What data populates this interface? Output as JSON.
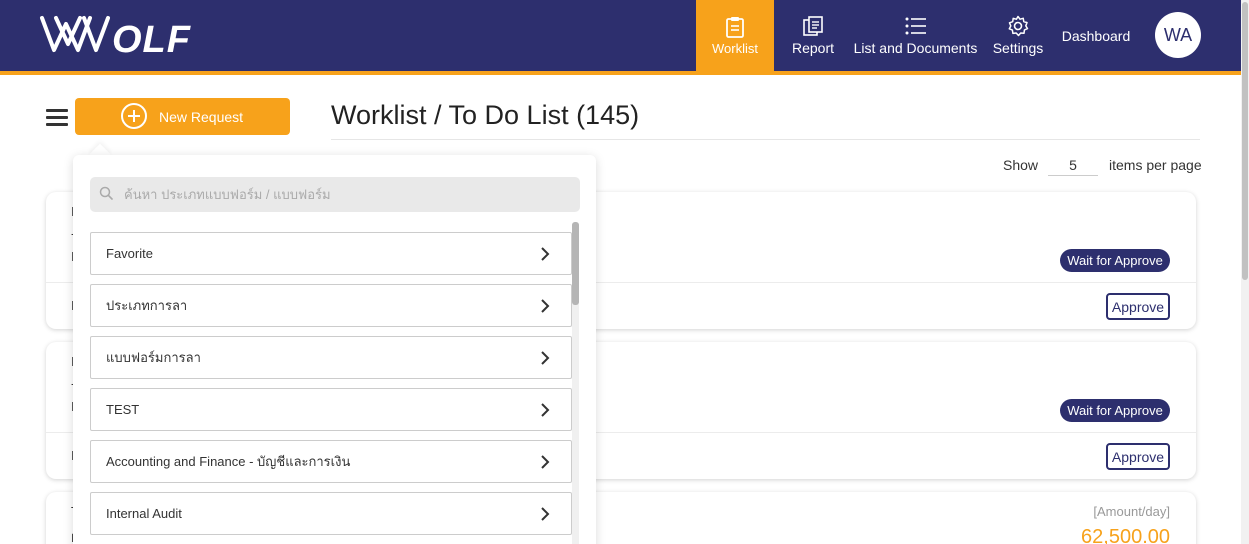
{
  "brand": {
    "logo_text": "WOLF"
  },
  "nav": {
    "items": [
      {
        "label": "Worklist",
        "icon": "clipboard-icon",
        "active": true
      },
      {
        "label": "Report",
        "icon": "report-icon",
        "active": false
      },
      {
        "label": "List and Documents",
        "icon": "list-icon",
        "active": false
      },
      {
        "label": "Settings",
        "icon": "gear-icon",
        "active": false
      },
      {
        "label": "Dashboard",
        "icon": "",
        "active": false
      }
    ],
    "avatar_initials": "WA"
  },
  "toolbar": {
    "new_request_label": "New Request"
  },
  "page": {
    "title": "Worklist / To Do List (145)",
    "show_label": "Show",
    "per_page_value": "5",
    "items_label": "items per page"
  },
  "cards": [
    {
      "stub_lines": [
        "I",
        "-",
        "I",
        "I"
      ],
      "status": "Wait for Approve",
      "action": "Approve"
    },
    {
      "stub_lines": [
        "I",
        "-",
        "I",
        "I"
      ],
      "status": "Wait for Approve",
      "action": "Approve"
    },
    {
      "stub_lines": [
        "T",
        "฿"
      ],
      "amount_label": "[Amount/day]",
      "amount_value": "62,500.00"
    }
  ],
  "dropdown": {
    "search_placeholder": "ค้นหา ประเภทแบบฟอร์ม / แบบฟอร์ม",
    "categories": [
      {
        "label": "Favorite"
      },
      {
        "label": "ประเภทการลา"
      },
      {
        "label": "แบบฟอร์มการลา"
      },
      {
        "label": "TEST"
      },
      {
        "label": "Accounting and Finance - บัญชีและการเงิน"
      },
      {
        "label": "Internal Audit"
      }
    ]
  },
  "colors": {
    "navy": "#2d2f6e",
    "accent": "#f7a21b"
  }
}
